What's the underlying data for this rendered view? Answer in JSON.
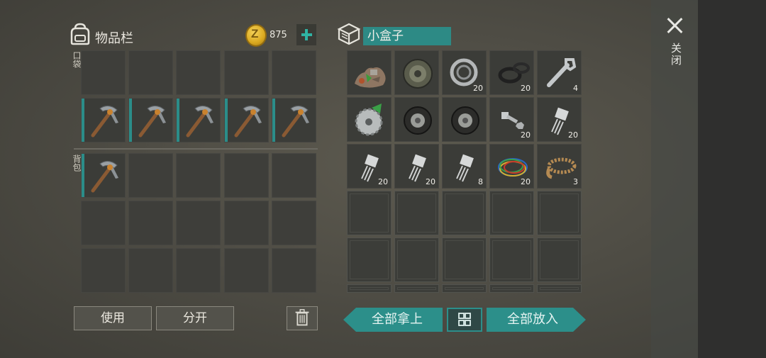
{
  "close": {
    "label": "关闭"
  },
  "inventory": {
    "title": "物品栏",
    "coins": "875",
    "pocket_label": "口袋",
    "backpack_label": "背包",
    "use_label": "使用",
    "split_label": "分开"
  },
  "container": {
    "title": "小盒子",
    "take_all_label": "全部拿上",
    "put_all_label": "全部放入",
    "items": [
      {
        "name": "scrap-pile",
        "count": ""
      },
      {
        "name": "car-wheel",
        "count": ""
      },
      {
        "name": "bearing",
        "count": "20"
      },
      {
        "name": "rubber-seals",
        "count": "20"
      },
      {
        "name": "wrench",
        "count": "4"
      },
      {
        "name": "saw-blade",
        "count": ""
      },
      {
        "name": "tire",
        "count": ""
      },
      {
        "name": "tire",
        "count": ""
      },
      {
        "name": "bolt-nut",
        "count": "20"
      },
      {
        "name": "transistor",
        "count": "20"
      },
      {
        "name": "transistor",
        "count": "20"
      },
      {
        "name": "transistor",
        "count": "20"
      },
      {
        "name": "transistor",
        "count": "8"
      },
      {
        "name": "wires",
        "count": "20"
      },
      {
        "name": "rope",
        "count": "3"
      }
    ]
  },
  "colors": {
    "accent": "#2c8f8a",
    "slot": "#3e3e3a",
    "coin": "#d9a81f"
  }
}
